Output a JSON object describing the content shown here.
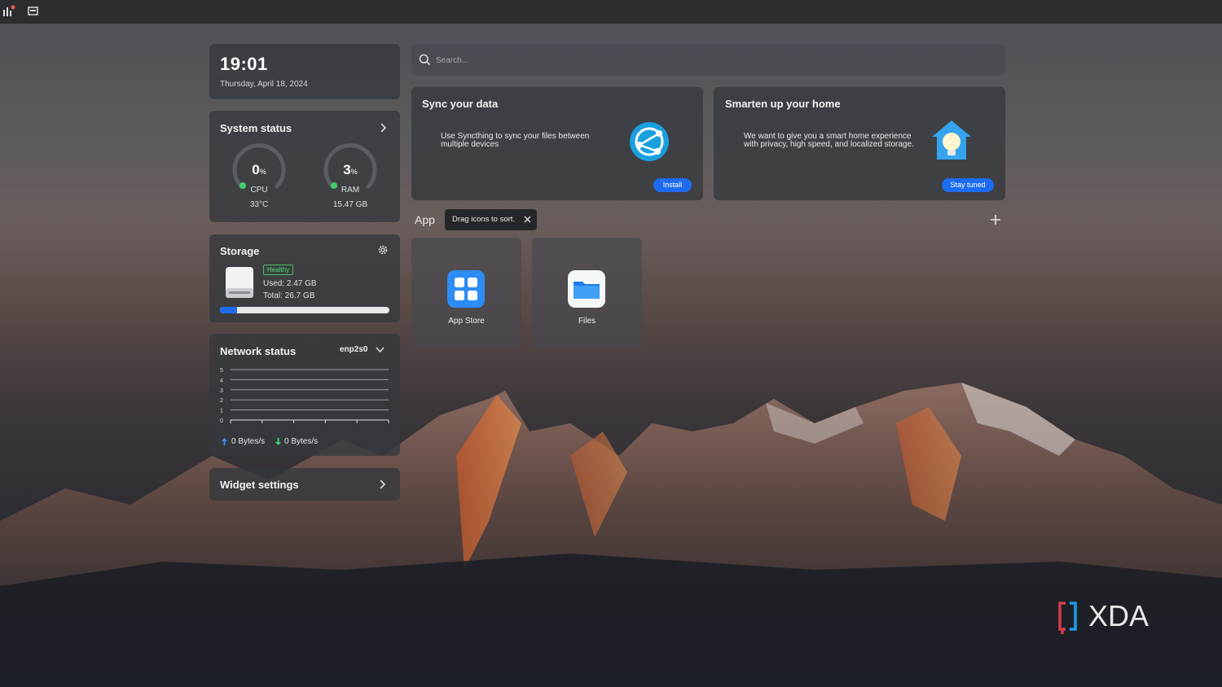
{
  "clock": {
    "time": "19:01",
    "date": "Thursday, April 18, 2024"
  },
  "system_status": {
    "title": "System status",
    "cpu": {
      "value": "0",
      "unit": "%",
      "label": "CPU",
      "sub": "33°C",
      "percent": 0
    },
    "ram": {
      "value": "3",
      "unit": "%",
      "label": "RAM",
      "sub": "15.47 GB",
      "percent": 3
    }
  },
  "storage": {
    "title": "Storage",
    "health": "Healthy",
    "used": "Used: 2.47 GB",
    "total": "Total: 26.7 GB",
    "used_fraction": 0.1
  },
  "network": {
    "title": "Network status",
    "interface": "enp2s0",
    "y_ticks": [
      "5",
      "4",
      "3",
      "2",
      "1",
      "0"
    ],
    "upload": "0 Bytes/s",
    "download": "0 Bytes/s"
  },
  "widget_settings": {
    "label": "Widget settings"
  },
  "search": {
    "placeholder": "Search..."
  },
  "promos": [
    {
      "title": "Sync your data",
      "desc_line1": "Use Syncthing to sync your files between",
      "desc_line2": "multiple devices",
      "button": "Install"
    },
    {
      "title": "Smarten up your home",
      "desc_line1": "We want to give you a smart home experience",
      "desc_line2": "with privacy, high speed, and localized storage.",
      "button": "Stay tuned"
    }
  ],
  "apps_section": {
    "title": "App",
    "tip": "Drag icons to sort.",
    "apps": [
      {
        "name": "App Store"
      },
      {
        "name": "Files"
      }
    ]
  },
  "watermark": "XDA",
  "colors": {
    "accent": "#1d6cf0",
    "gauge_green": "#3ecf6a",
    "healthy": "#5fd07a"
  }
}
